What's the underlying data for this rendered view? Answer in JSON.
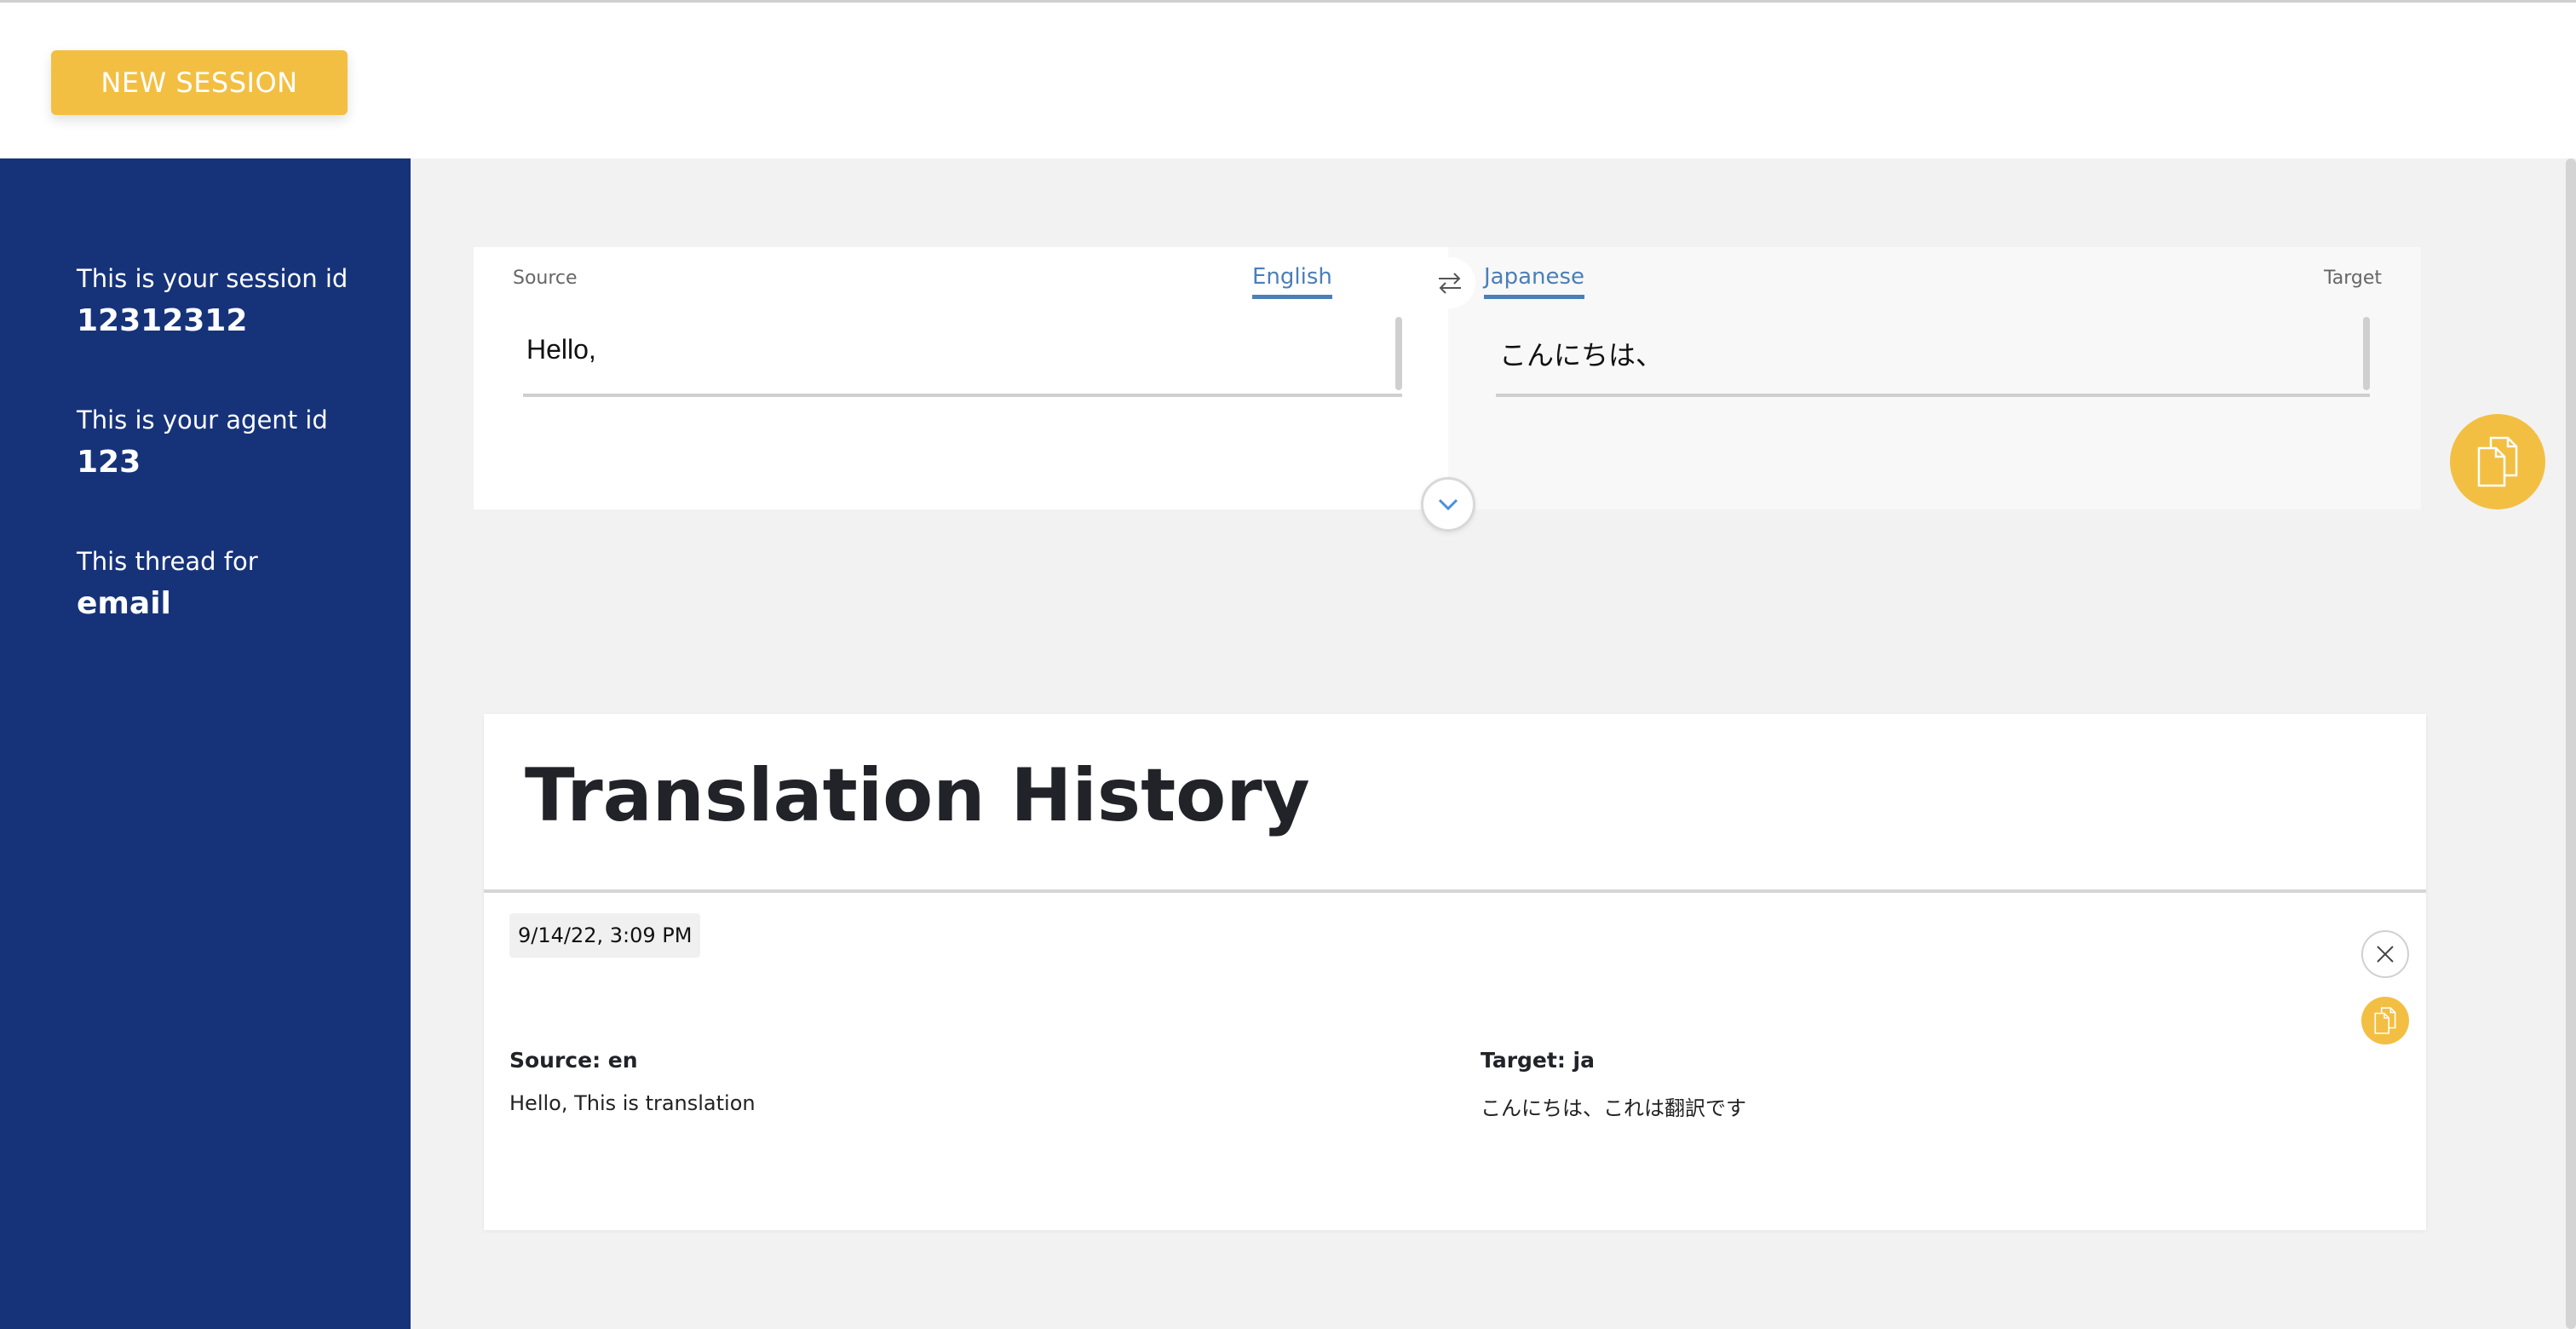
{
  "header": {
    "new_session_label": "NEW SESSION"
  },
  "sidebar": {
    "items": [
      {
        "label": "This is your session id",
        "value": "12312312"
      },
      {
        "label": "This is your agent id",
        "value": "123"
      },
      {
        "label": "This thread for",
        "value": "email"
      }
    ]
  },
  "translator": {
    "source": {
      "label": "Source",
      "language": "English",
      "text": "Hello,"
    },
    "target": {
      "label": "Target",
      "language": "Japanese",
      "text": "こんにちは、"
    },
    "icons": {
      "swap": "swap-arrows-icon",
      "expand": "chevron-down-icon",
      "copy": "copy-icon"
    }
  },
  "history": {
    "title": "Translation History",
    "entries": [
      {
        "timestamp": "9/14/22, 3:09 PM",
        "source_heading": "Source: en",
        "source_text": "Hello, This is translation",
        "target_heading": "Target: ja",
        "target_text": "こんにちは、これは翻訳です"
      }
    ]
  },
  "colors": {
    "accent": "#f3bf43",
    "sidebar": "#16337a",
    "link": "#4a7fb8"
  }
}
